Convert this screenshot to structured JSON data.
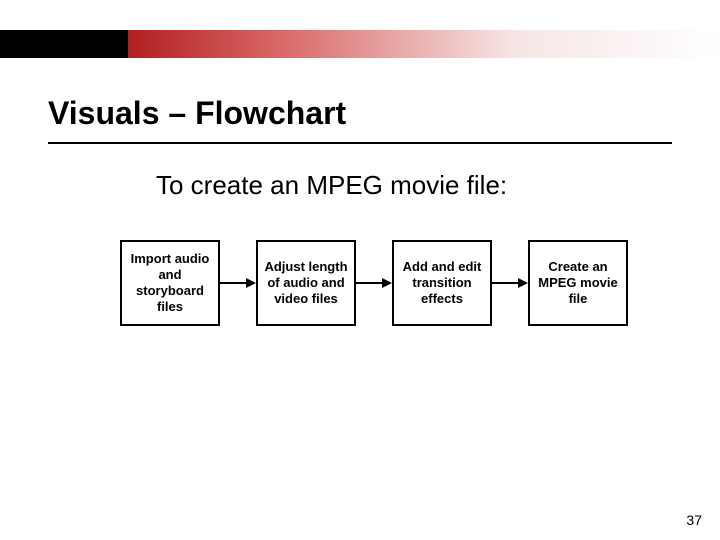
{
  "header": {
    "title": "Visuals – Flowchart"
  },
  "content": {
    "subtitle": "To create an MPEG movie file:",
    "steps": [
      "Import audio and storyboard files",
      "Adjust length of audio and video files",
      "Add and edit transition effects",
      "Create an MPEG movie file"
    ]
  },
  "footer": {
    "page_number": "37"
  }
}
